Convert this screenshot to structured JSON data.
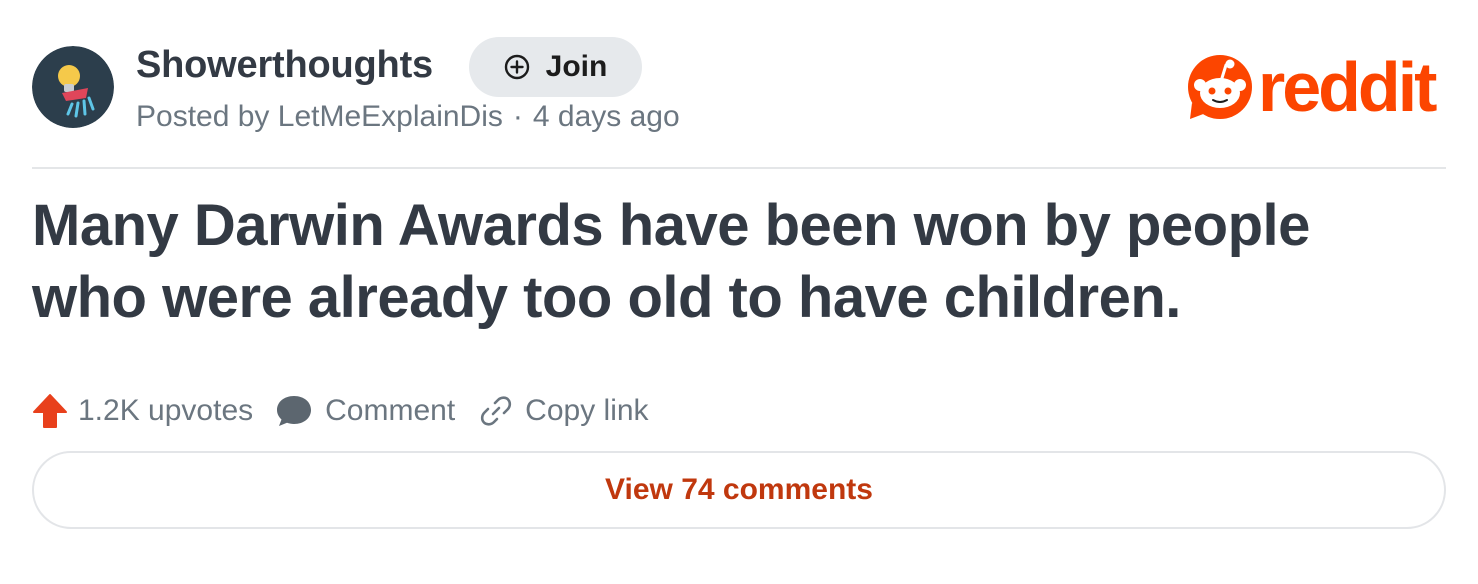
{
  "post": {
    "subreddit": "Showerthoughts",
    "join_label": "Join",
    "posted_by_prefix": "Posted by",
    "author": "LetMeExplainDis",
    "separator": "·",
    "time_ago": "4 days ago",
    "title": "Many Darwin Awards have been won by people who were already too old to have children."
  },
  "brand": {
    "wordmark": "reddit",
    "color": "#fc4500"
  },
  "actions": {
    "upvotes_label": "1.2K upvotes",
    "comment_label": "Comment",
    "copy_link_label": "Copy link"
  },
  "footer": {
    "view_comments_label": "View 74 comments"
  },
  "icons": {
    "avatar": "showerhead-lightbulb-icon",
    "join": "plus-circle-icon",
    "logo": "reddit-snoo-icon",
    "upvote": "upvote-arrow-icon",
    "comment": "comment-bubble-icon",
    "copy_link": "link-icon"
  },
  "colors": {
    "title": "#333a44",
    "meta": "#6b7680",
    "upvote": "#e8401c",
    "view_comments": "#c0380e"
  }
}
